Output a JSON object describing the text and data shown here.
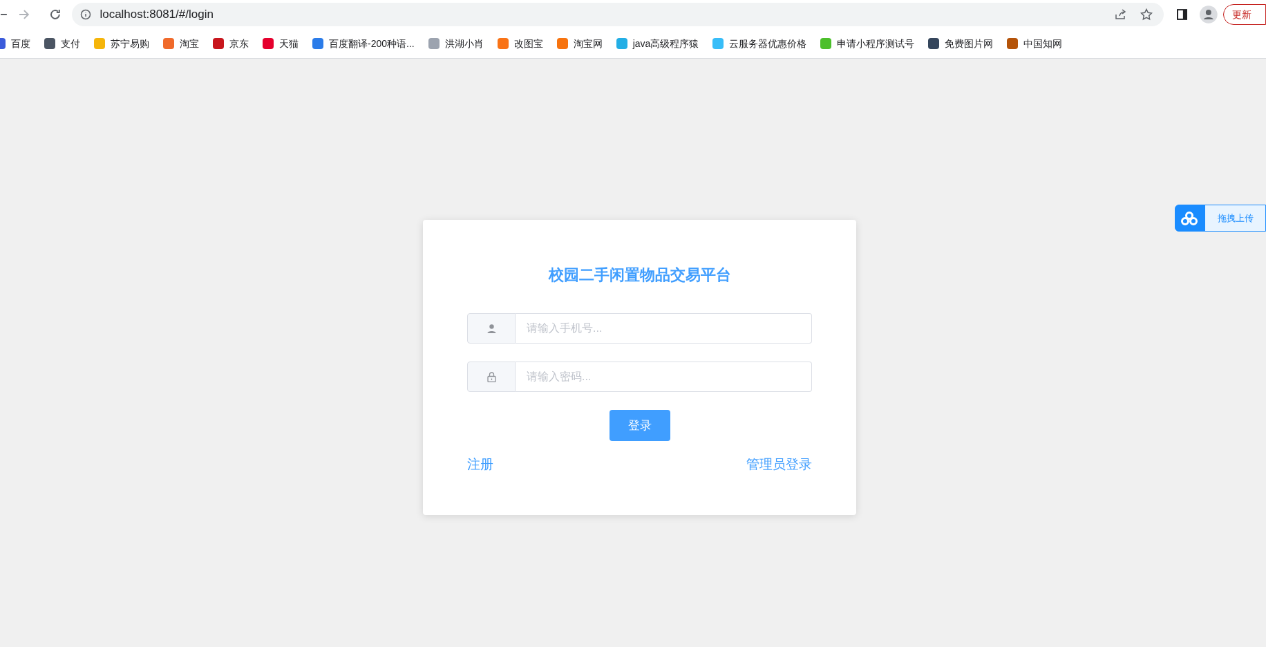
{
  "browser": {
    "address": "localhost:8081/#/login",
    "update_button": "更新"
  },
  "bookmarks": [
    {
      "label": "百度",
      "color": "#3b5bdb"
    },
    {
      "label": "支付",
      "color": "#4b5563"
    },
    {
      "label": "苏宁易购",
      "color": "#f5b50a"
    },
    {
      "label": "淘宝",
      "color": "#f06a2b"
    },
    {
      "label": "京东",
      "color": "#c8161d"
    },
    {
      "label": "天猫",
      "color": "#e5002d"
    },
    {
      "label": "百度翻译-200种语...",
      "color": "#2b7ce9"
    },
    {
      "label": "洪湖小肖",
      "color": "#9ca3af"
    },
    {
      "label": "改图宝",
      "color": "#f97316"
    },
    {
      "label": "淘宝网",
      "color": "#f7730e"
    },
    {
      "label": "java高级程序猿",
      "color": "#23aee5"
    },
    {
      "label": "云服务器优惠价格",
      "color": "#38bdf8"
    },
    {
      "label": "申请小程序测试号",
      "color": "#4cbf2b"
    },
    {
      "label": "免费图片网",
      "color": "#35465c"
    },
    {
      "label": "中国知网",
      "color": "#b45309"
    }
  ],
  "login": {
    "title": "校园二手闲置物品交易平台",
    "fields": [
      {
        "kind": "phone",
        "placeholder": "请输入手机号..."
      },
      {
        "kind": "password",
        "placeholder": "请输入密码..."
      }
    ],
    "submit": "登录",
    "register_link": "注册",
    "admin_link": "管理员登录"
  },
  "upload_widget": {
    "label": "拖拽上传"
  }
}
